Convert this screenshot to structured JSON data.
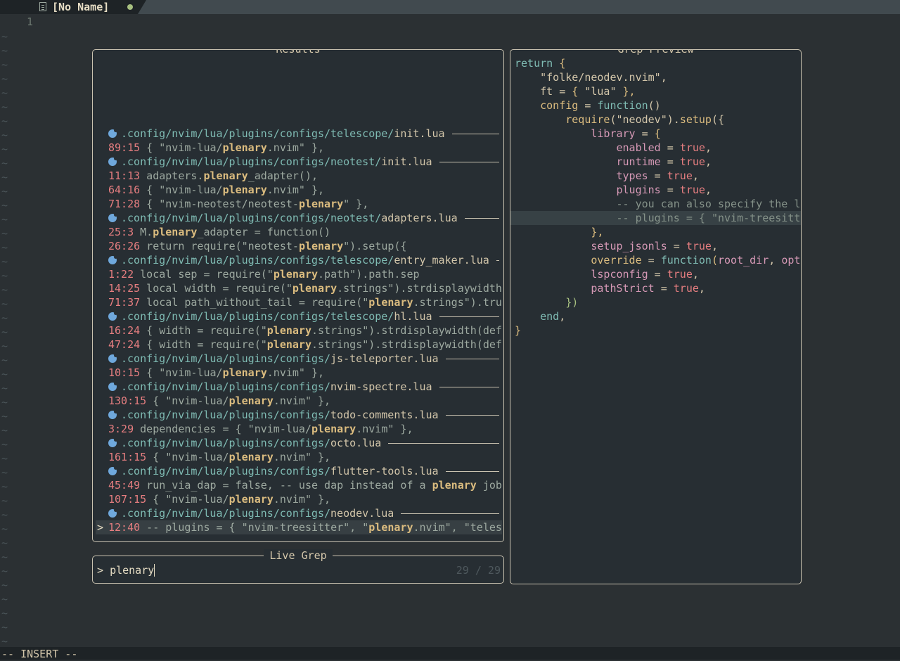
{
  "tab": {
    "title": "[No Name]"
  },
  "editor": {
    "line_number": "1"
  },
  "statusline": {
    "mode": "-- INSERT --"
  },
  "results": {
    "title": "Results",
    "rows": [
      {
        "kind": "file",
        "dir": ".config/nvim/lua/plugins/configs/telescope/",
        "file": "init.lua"
      },
      {
        "kind": "match",
        "loc": "89:15",
        "pre": " { \"nvim-lua/",
        "match": "plenary",
        "post": ".nvim\" },"
      },
      {
        "kind": "file",
        "dir": ".config/nvim/lua/plugins/configs/neotest/",
        "file": "init.lua"
      },
      {
        "kind": "match",
        "loc": "11:13",
        "pre": " adapters.",
        "match": "plenary",
        "post": "_adapter(),"
      },
      {
        "kind": "match",
        "loc": "64:16",
        "pre": " { \"nvim-lua/",
        "match": "plenary",
        "post": ".nvim\" },"
      },
      {
        "kind": "match",
        "loc": "71:28",
        "pre": " { \"nvim-neotest/neotest-",
        "match": "plenary",
        "post": "\" },"
      },
      {
        "kind": "file",
        "dir": ".config/nvim/lua/plugins/configs/neotest/",
        "file": "adapters.lua"
      },
      {
        "kind": "match",
        "loc": "25:3",
        "pre": " M.",
        "match": "plenary",
        "post": "_adapter = function()"
      },
      {
        "kind": "match",
        "loc": "26:26",
        "pre": " return require(\"neotest-",
        "match": "plenary",
        "post": "\").setup({"
      },
      {
        "kind": "file",
        "dir": ".config/nvim/lua/plugins/configs/telescope/",
        "file": "entry_maker.lua"
      },
      {
        "kind": "match",
        "loc": "1:22",
        "pre": " local sep = require(\"",
        "match": "plenary",
        "post": ".path\").path.sep"
      },
      {
        "kind": "match",
        "loc": "14:25",
        "pre": " local width = require(\"",
        "match": "plenary",
        "post": ".strings\").strdisplaywidth"
      },
      {
        "kind": "match",
        "loc": "71:37",
        "pre": " local path_without_tail = require(\"",
        "match": "plenary",
        "post": ".strings\").tru"
      },
      {
        "kind": "file",
        "dir": ".config/nvim/lua/plugins/configs/telescope/",
        "file": "hl.lua"
      },
      {
        "kind": "match",
        "loc": "16:24",
        "pre": " { width = require(\"",
        "match": "plenary",
        "post": ".strings\").strdisplaywidth(def"
      },
      {
        "kind": "match",
        "loc": "47:24",
        "pre": " { width = require(\"",
        "match": "plenary",
        "post": ".strings\").strdisplaywidth(def"
      },
      {
        "kind": "file",
        "dir": ".config/nvim/lua/plugins/configs/",
        "file": "js-teleporter.lua"
      },
      {
        "kind": "match",
        "loc": "10:15",
        "pre": " { \"nvim-lua/",
        "match": "plenary",
        "post": ".nvim\" },"
      },
      {
        "kind": "file",
        "dir": ".config/nvim/lua/plugins/configs/",
        "file": "nvim-spectre.lua"
      },
      {
        "kind": "match",
        "loc": "130:15",
        "pre": " { \"nvim-lua/",
        "match": "plenary",
        "post": ".nvim\" },"
      },
      {
        "kind": "file",
        "dir": ".config/nvim/lua/plugins/configs/",
        "file": "todo-comments.lua"
      },
      {
        "kind": "match",
        "loc": "3:29",
        "pre": " dependencies = { \"nvim-lua/",
        "match": "plenary",
        "post": ".nvim\" },"
      },
      {
        "kind": "file",
        "dir": ".config/nvim/lua/plugins/configs/",
        "file": "octo.lua"
      },
      {
        "kind": "match",
        "loc": "161:15",
        "pre": " { \"nvim-lua/",
        "match": "plenary",
        "post": ".nvim\" },"
      },
      {
        "kind": "file",
        "dir": ".config/nvim/lua/plugins/configs/",
        "file": "flutter-tools.lua"
      },
      {
        "kind": "match",
        "loc": "45:49",
        "pre": " run_via_dap = false, -- use dap instead of a ",
        "match": "plenary",
        "post": " job"
      },
      {
        "kind": "match",
        "loc": "107:15",
        "pre": " { \"nvim-lua/",
        "match": "plenary",
        "post": ".nvim\" },"
      },
      {
        "kind": "file",
        "dir": ".config/nvim/lua/plugins/configs/",
        "file": "neodev.lua"
      },
      {
        "kind": "match",
        "selected": true,
        "caret": ">",
        "loc": "12:40",
        "pre": " -- plugins = { \"nvim-treesitter\", \"",
        "match": "plenary",
        "post": ".nvim\", \"teles"
      }
    ]
  },
  "prompt": {
    "title": "Live Grep",
    "prefix": "> ",
    "query": "plenary",
    "count": "29 / 29"
  },
  "preview": {
    "title": "Grep Preview",
    "lines": [
      [
        [
          "k",
          "return"
        ],
        [
          "p",
          " {"
        ]
      ],
      [
        [
          "s",
          "    \"folke/neodev.nvim\","
        ]
      ],
      [
        [
          "s",
          "    ft = "
        ],
        [
          "p",
          "{ "
        ],
        [
          "s",
          "\"lua\" "
        ],
        [
          "p",
          "},"
        ]
      ],
      [
        [
          "p",
          "    config"
        ],
        [
          "s",
          " = "
        ],
        [
          "k",
          "function"
        ],
        [
          "s",
          "()"
        ]
      ],
      [
        [
          "p",
          "        require"
        ],
        [
          "s",
          "(\"neodev\")."
        ],
        [
          "p",
          "setup"
        ],
        [
          "s",
          "({"
        ]
      ],
      [
        [
          "pr",
          "            library"
        ],
        [
          "s",
          " = "
        ],
        [
          "p",
          "{"
        ]
      ],
      [
        [
          "pr",
          "                enabled"
        ],
        [
          "s",
          " = "
        ],
        [
          "t",
          "true"
        ],
        [
          "s",
          ","
        ]
      ],
      [
        [
          "pr",
          "                runtime"
        ],
        [
          "s",
          " = "
        ],
        [
          "t",
          "true"
        ],
        [
          "s",
          ","
        ]
      ],
      [
        [
          "pr",
          "                types"
        ],
        [
          "s",
          " = "
        ],
        [
          "t",
          "true"
        ],
        [
          "s",
          ","
        ]
      ],
      [
        [
          "pr",
          "                plugins"
        ],
        [
          "s",
          " = "
        ],
        [
          "t",
          "true"
        ],
        [
          "s",
          ","
        ]
      ],
      [
        [
          "c",
          "                -- you can also specify the l"
        ]
      ],
      [
        [
          "c",
          "                -- plugins = { \"nvim-treesitt"
        ]
      ],
      [
        [
          "p",
          "            },"
        ]
      ],
      [
        [
          "pr",
          "            setup_jsonls"
        ],
        [
          "s",
          " = "
        ],
        [
          "t",
          "true"
        ],
        [
          "s",
          ","
        ]
      ],
      [
        [
          "p",
          "            override"
        ],
        [
          "s",
          " = "
        ],
        [
          "k",
          "function"
        ],
        [
          "p",
          "("
        ],
        [
          "pr",
          "root_dir"
        ],
        [
          "s",
          ", "
        ],
        [
          "pr",
          "opt"
        ]
      ],
      [
        [
          "pr",
          "            lspconfig"
        ],
        [
          "s",
          " = "
        ],
        [
          "t",
          "true"
        ],
        [
          "s",
          ","
        ]
      ],
      [
        [
          "pr",
          "            pathStrict"
        ],
        [
          "s",
          " = "
        ],
        [
          "t",
          "true"
        ],
        [
          "s",
          ","
        ]
      ],
      [
        [
          "f",
          "        })"
        ]
      ],
      [
        [
          "k",
          "    end"
        ],
        [
          "s",
          ","
        ]
      ],
      [
        [
          "p",
          "}"
        ]
      ]
    ],
    "cursor_line": 11
  },
  "colors": {
    "bg": "#2b3033",
    "accent_red": "#e67e80",
    "accent_yellow": "#dbbc7f",
    "accent_blue": "#7fbbb3"
  }
}
